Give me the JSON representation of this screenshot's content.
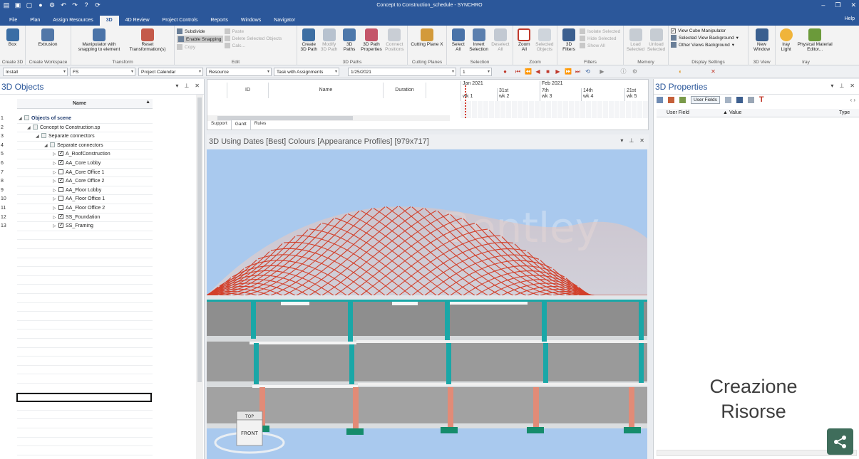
{
  "window": {
    "title": "Concept to Construction_schedule - SYNCHRO",
    "help": "Help"
  },
  "ribbon_tabs": [
    "File",
    "Plan",
    "Assign Resources",
    "3D",
    "4D Review",
    "Project Controls",
    "Reports",
    "Windows",
    "Navigator"
  ],
  "active_tab": "3D",
  "ribbon": {
    "create3d": {
      "label": "Create 3D",
      "box": "Box"
    },
    "create_workspace": {
      "label": "Create Workspace",
      "extrusion": "Extrusion"
    },
    "transform": {
      "label": "Transform",
      "manipulator": "Manipulator with snapping to element",
      "reset": "Reset Transformation(s)"
    },
    "edit": {
      "label": "Edit",
      "subdivide": "Subdivide",
      "enable_snapping": "Enable Snapping",
      "copy": "Copy",
      "paste": "Paste",
      "delete_selected": "Delete Selected Objects",
      "calc": "Calc..."
    },
    "paths": {
      "label": "3D Paths",
      "create": "Create 3D Path",
      "modify": "Modify 3D Path",
      "paths": "3D Paths",
      "path_props": "3D Path Properties",
      "connect": "Connect Positions"
    },
    "cutting": {
      "label": "Cutting Planes",
      "cutting_plane": "Cutting Plane X"
    },
    "selection": {
      "label": "Selection",
      "select_all": "Select All",
      "invert": "Invert Selection",
      "deselect": "Deselect All"
    },
    "zoom": {
      "label": "Zoom",
      "zoom_all": "Zoom All",
      "selected_objects": "Selected Objects"
    },
    "filters": {
      "label": "Filters",
      "filters": "3D Filters",
      "isolate": "Isolate Selected",
      "hide": "Hide Selected",
      "show_all": "Show All"
    },
    "memory": {
      "label": "Memory",
      "load": "Load Selected",
      "unload": "Unload Selected"
    },
    "display": {
      "label": "Display Settings",
      "view_cube": "View Cube Manipulator",
      "selected_bg": "Selected View Background",
      "other_bg": "Other Views Background"
    },
    "view3d": {
      "label": "3D View",
      "new_window": "New Window"
    },
    "iray": {
      "label": "Iray",
      "light": "Iray Light",
      "material": "Physical Material Editor..."
    }
  },
  "toolbar": {
    "install": "Install",
    "fs": "FS",
    "calendar": "Project Calendar",
    "resource": "Resource",
    "task_with_assignments": "Task with Assignments",
    "date": "1/25/2021",
    "step": "1"
  },
  "left_panel": {
    "title": "3D Objects",
    "column": "Name",
    "rows": [
      {
        "num": "1",
        "label": "Objects of scene",
        "indent": 0,
        "bold": true,
        "check": "part",
        "expanded": true
      },
      {
        "num": "2",
        "label": "Concept to Construction.sp",
        "indent": 1,
        "bold": false,
        "check": "part",
        "expanded": true
      },
      {
        "num": "3",
        "label": "Separate connectors",
        "indent": 2,
        "bold": false,
        "check": "part",
        "expanded": true
      },
      {
        "num": "4",
        "label": "Separate connectors",
        "indent": 3,
        "bold": false,
        "check": "part",
        "expanded": true
      },
      {
        "num": "5",
        "label": "A_RoofConstruction",
        "indent": 4,
        "bold": false,
        "check": "on",
        "expanded": false
      },
      {
        "num": "6",
        "label": "AA_Core Lobby",
        "indent": 4,
        "bold": false,
        "check": "on",
        "expanded": false
      },
      {
        "num": "7",
        "label": "AA_Core Office 1",
        "indent": 4,
        "bold": false,
        "check": "off",
        "expanded": false
      },
      {
        "num": "8",
        "label": "AA_Core Office 2",
        "indent": 4,
        "bold": false,
        "check": "on",
        "expanded": false
      },
      {
        "num": "9",
        "label": "AA_Floor Lobby",
        "indent": 4,
        "bold": false,
        "check": "off",
        "expanded": false
      },
      {
        "num": "10",
        "label": "AA_Floor Office 1",
        "indent": 4,
        "bold": false,
        "check": "off",
        "expanded": false
      },
      {
        "num": "11",
        "label": "AA_Floor Office 2",
        "indent": 4,
        "bold": false,
        "check": "off",
        "expanded": false
      },
      {
        "num": "12",
        "label": "SS_Foundation",
        "indent": 4,
        "bold": false,
        "check": "on",
        "expanded": false
      },
      {
        "num": "13",
        "label": "SS_Framing",
        "indent": 4,
        "bold": false,
        "check": "on",
        "expanded": false
      }
    ]
  },
  "gantt": {
    "columns": [
      "ID",
      "Name",
      "Duration"
    ],
    "tabs": [
      "Support",
      "Gantt",
      "Rules"
    ],
    "active_tab": "Gantt",
    "months": [
      "Jan 2021",
      "Feb 2021"
    ],
    "weeks": [
      {
        "date": "",
        "wk": "wk 1"
      },
      {
        "date": "31st",
        "wk": "wk 2"
      },
      {
        "date": "7th",
        "wk": "wk 3"
      },
      {
        "date": "14th",
        "wk": "wk 4"
      },
      {
        "date": "21st",
        "wk": "wk 5"
      }
    ]
  },
  "viewport": {
    "title": "3D Using Dates [Best] Colours [Appearance Profiles]  [979x717]",
    "watermark": "Bentley",
    "cube_top": "TOP",
    "cube_front": "FRONT"
  },
  "right_panel": {
    "title": "3D Properties",
    "user_fields": "User Fields",
    "columns": [
      "User Field",
      "Value",
      "Type"
    ],
    "overlay_line1": "Creazione",
    "overlay_line2": "Risorse"
  },
  "colors": {
    "accent": "#2b579a",
    "sky": "#a9c9ee",
    "roof_grid": "#d2402b",
    "column_teal": "#1aa7a7",
    "column_salmon": "#e28b77",
    "slab": "#9c9c9c"
  }
}
